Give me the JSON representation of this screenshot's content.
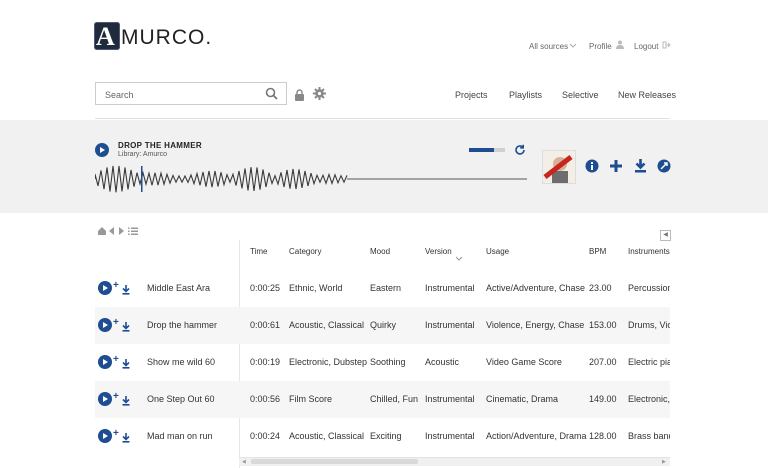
{
  "brand": {
    "logo_letter": "A",
    "logo_rest": "MURCO."
  },
  "topbar": {
    "sources": "All sources",
    "profile": "Profile",
    "logout": "Logout"
  },
  "search": {
    "placeholder": "Search"
  },
  "nav": {
    "items": [
      "Projects",
      "Playlists",
      "Selective",
      "New Releases"
    ]
  },
  "player": {
    "title": "DROP THE HAMMER",
    "library": "Library: Amurco",
    "volume_fraction": 0.7
  },
  "table": {
    "headers": [
      "Time",
      "Category",
      "Mood",
      "Version",
      "Usage",
      "BPM",
      "Instruments"
    ],
    "rows": [
      {
        "name": "Middle East Ara",
        "time": "0:00:25",
        "category": "Ethnic, World",
        "mood": "Eastern",
        "version": "Instrumental",
        "usage": "Active/Adventure, Chase",
        "bpm": "23.00",
        "instruments": "Percussion"
      },
      {
        "name": "Drop the hammer",
        "time": "0:00:61",
        "category": "Acoustic, Classical",
        "mood": "Quirky",
        "version": "Instrumental",
        "usage": "Violence, Energy, Chase",
        "bpm": "153.00",
        "instruments": "Drums, Viol"
      },
      {
        "name": "Show me wild 60",
        "time": "0:00:19",
        "category": "Electronic, Dubstep",
        "mood": "Soothing",
        "version": "Acoustic",
        "usage": "Video Game Score",
        "bpm": "207.00",
        "instruments": "Electric pia"
      },
      {
        "name": "One Step Out 60",
        "time": "0:00:56",
        "category": "Film Score",
        "mood": "Chilled, Fun",
        "version": "Instrumental",
        "usage": "Cinematic, Drama",
        "bpm": "149.00",
        "instruments": "Electronic, I"
      },
      {
        "name": "Mad man on run",
        "time": "0:00:24",
        "category": "Acoustic, Classical",
        "mood": "Exciting",
        "version": "Instrumental",
        "usage": "Action/Adventure, Drama",
        "bpm": "128.00",
        "instruments": "Brass band"
      }
    ]
  },
  "colors": {
    "accent": "#1e4d92"
  }
}
